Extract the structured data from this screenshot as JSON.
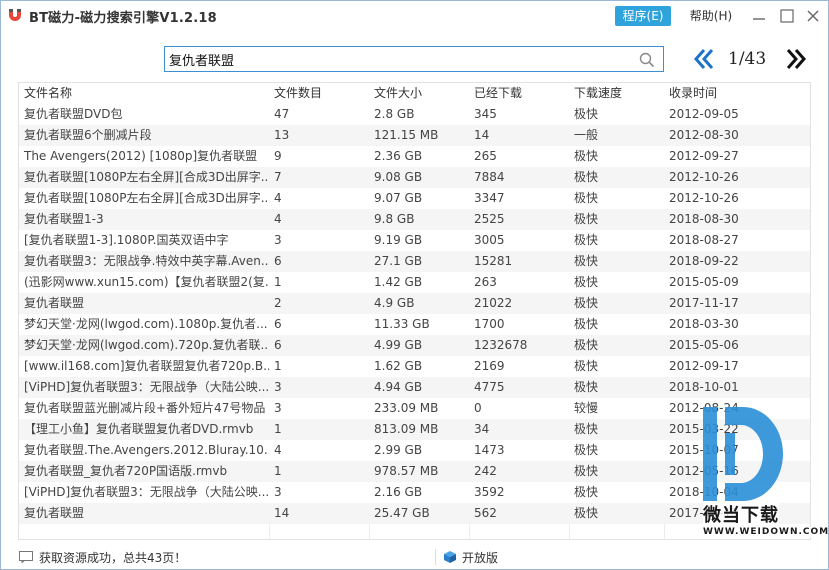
{
  "window": {
    "title": "BT磁力-磁力搜索引擎V1.2.18",
    "menu_program": "程序(E)",
    "menu_help": "帮助(H)"
  },
  "search": {
    "value": "复仇者联盟"
  },
  "pager": {
    "text": "1/43"
  },
  "table": {
    "headers": [
      "文件名称",
      "文件数目",
      "文件大小",
      "已经下载",
      "下载速度",
      "收录时间"
    ],
    "rows": [
      [
        "复仇者联盟DVD包",
        "47",
        "2.8 GB",
        "345",
        "极快",
        "2012-09-05"
      ],
      [
        "复仇者联盟6个删减片段",
        "13",
        "121.15 MB",
        "14",
        "一般",
        "2012-08-30"
      ],
      [
        "The Avengers(2012) [1080p]复仇者联盟",
        "9",
        "2.36 GB",
        "265",
        "极快",
        "2012-09-27"
      ],
      [
        "复仇者联盟[1080P左右全屏][合成3D出屏字...",
        "7",
        "9.08 GB",
        "7884",
        "极快",
        "2012-10-26"
      ],
      [
        "复仇者联盟[1080P左右全屏][合成3D出屏字...",
        "4",
        "9.07 GB",
        "3347",
        "极快",
        "2012-10-26"
      ],
      [
        "复仇者联盟1-3",
        "4",
        "9.8 GB",
        "2525",
        "极快",
        "2018-08-30"
      ],
      [
        "[复仇者联盟1-3].1080P.国英双语中字",
        "3",
        "9.19 GB",
        "3005",
        "极快",
        "2018-08-27"
      ],
      [
        "复仇者联盟3：无限战争.特效中英字幕.Aven...",
        "6",
        "27.1 GB",
        "15281",
        "极快",
        "2018-09-22"
      ],
      [
        "(迅影网www.xun15.com)【复仇者联盟2(复...",
        "1",
        "1.42 GB",
        "263",
        "极快",
        "2015-05-09"
      ],
      [
        "复仇者联盟",
        "2",
        "4.9 GB",
        "21022",
        "极快",
        "2017-11-17"
      ],
      [
        "梦幻天堂·龙网(lwgod.com).1080p.复仇者...",
        "6",
        "11.33 GB",
        "1700",
        "极快",
        "2018-03-30"
      ],
      [
        "梦幻天堂·龙网(lwgod.com).720p.复仇者联...",
        "6",
        "4.99 GB",
        "1232678",
        "极快",
        "2015-05-06"
      ],
      [
        "[www.il168.com]复仇者联盟复仇者720p.B...",
        "1",
        "1.62 GB",
        "2169",
        "极快",
        "2012-09-17"
      ],
      [
        "[ViPHD]复仇者联盟3：无限战争（大陆公映...",
        "3",
        "4.94 GB",
        "4775",
        "极快",
        "2018-10-01"
      ],
      [
        "复仇者联盟蓝光删减片段+番外短片47号物品",
        "3",
        "233.09 MB",
        "0",
        "较慢",
        "2012-08-24"
      ],
      [
        "【理工小鱼】复仇者联盟复仇者DVD.rmvb",
        "1",
        "813.09 MB",
        "34",
        "极快",
        "2015-03-22"
      ],
      [
        "复仇者联盟.The.Avengers.2012.Bluray.10...",
        "4",
        "2.99 GB",
        "1473",
        "极快",
        "2015-10-07"
      ],
      [
        "复仇者联盟_复仇者720P国语版.rmvb",
        "1",
        "978.57 MB",
        "242",
        "极快",
        "2012-05-16"
      ],
      [
        "[ViPHD]复仇者联盟3：无限战争（大陆公映...",
        "3",
        "2.16 GB",
        "3592",
        "极快",
        "2018-10-04"
      ],
      [
        "复仇者联盟",
        "14",
        "25.47 GB",
        "562",
        "极快",
        "2017-11-13"
      ]
    ]
  },
  "status": {
    "message": "获取资源成功，总共43页！",
    "open_source": "开放版"
  },
  "watermark": {
    "brand": "微当下载",
    "url": "WWW.WEIDOWN.COM"
  },
  "colors": {
    "accent": "#2ea3dc",
    "pager_arrow": "#1e73c8",
    "border": "#3c8fd0",
    "watermark_blue": "#2a8fd8"
  },
  "icons": {
    "app": "magnet-icon",
    "search": "search-icon",
    "prev": "double-chevron-left-icon",
    "next": "double-chevron-right-icon",
    "status": "message-icon",
    "open_source": "cube-icon"
  }
}
